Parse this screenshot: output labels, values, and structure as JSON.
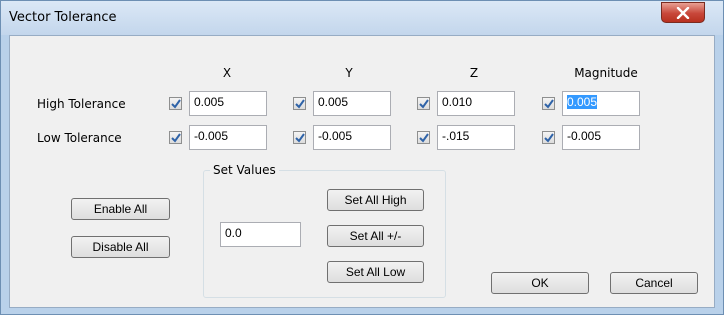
{
  "window": {
    "title": "Vector Tolerance",
    "close_icon": "close-x-icon"
  },
  "columns": [
    "X",
    "Y",
    "Z",
    "Magnitude"
  ],
  "rows": [
    {
      "label": "High Tolerance",
      "values": [
        "0.005",
        "0.005",
        "0.010",
        "0.005"
      ],
      "checked": [
        true,
        true,
        true,
        true
      ]
    },
    {
      "label": "Low Tolerance",
      "values": [
        "-0.005",
        "-0.005",
        "-.015",
        "-0.005"
      ],
      "checked": [
        true,
        true,
        true,
        true
      ]
    }
  ],
  "buttons": {
    "enable_all": "Enable All",
    "disable_all": "Disable All",
    "ok": "OK",
    "cancel": "Cancel"
  },
  "set_values": {
    "group_label": "Set Values",
    "value": "0.0",
    "set_all_high": "Set All High",
    "set_all_pm": "Set All +/-",
    "set_all_low": "Set All Low"
  },
  "colors": {
    "title_bar": "#c8daed",
    "client_bg": "#f0f0f0",
    "check_mark": "#2f63a8",
    "selection": "#3399ff"
  }
}
